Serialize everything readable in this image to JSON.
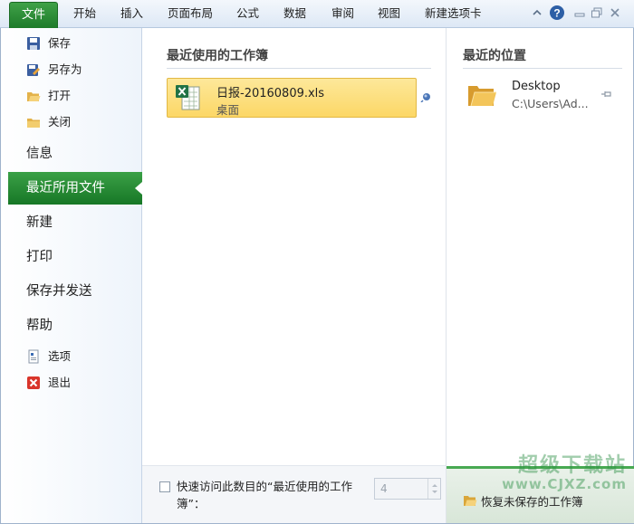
{
  "ribbon": {
    "file_tab": "文件",
    "tabs": [
      "开始",
      "插入",
      "页面布局",
      "公式",
      "数据",
      "审阅",
      "视图",
      "新建选项卡"
    ]
  },
  "nav": {
    "save": "保存",
    "save_as": "另存为",
    "open": "打开",
    "close": "关闭",
    "info": "信息",
    "recent": "最近所用文件",
    "new": "新建",
    "print": "打印",
    "save_send": "保存并发送",
    "help": "帮助",
    "options": "选项",
    "exit": "退出"
  },
  "recent_workbooks": {
    "title": "最近使用的工作簿",
    "items": [
      {
        "name": "日报-20160809.xls",
        "location": "桌面",
        "icon": "excel-file-icon"
      }
    ],
    "quick_access_label": "快速访问此数目的“最近使用的工作簿”：",
    "quick_access_count": "4",
    "quick_access_checked": false
  },
  "recent_places": {
    "title": "最近的位置",
    "items": [
      {
        "name": "Desktop",
        "path": "C:\\Users\\Ad...",
        "icon": "folder-icon"
      }
    ],
    "recover_label": "恢复未保存的工作簿"
  },
  "watermark": {
    "line1": "超级下载站",
    "line2": "www.CJXZ.com"
  },
  "colors": {
    "accent_green": "#1e7b2a",
    "highlight_yellow": "#fcd766"
  }
}
